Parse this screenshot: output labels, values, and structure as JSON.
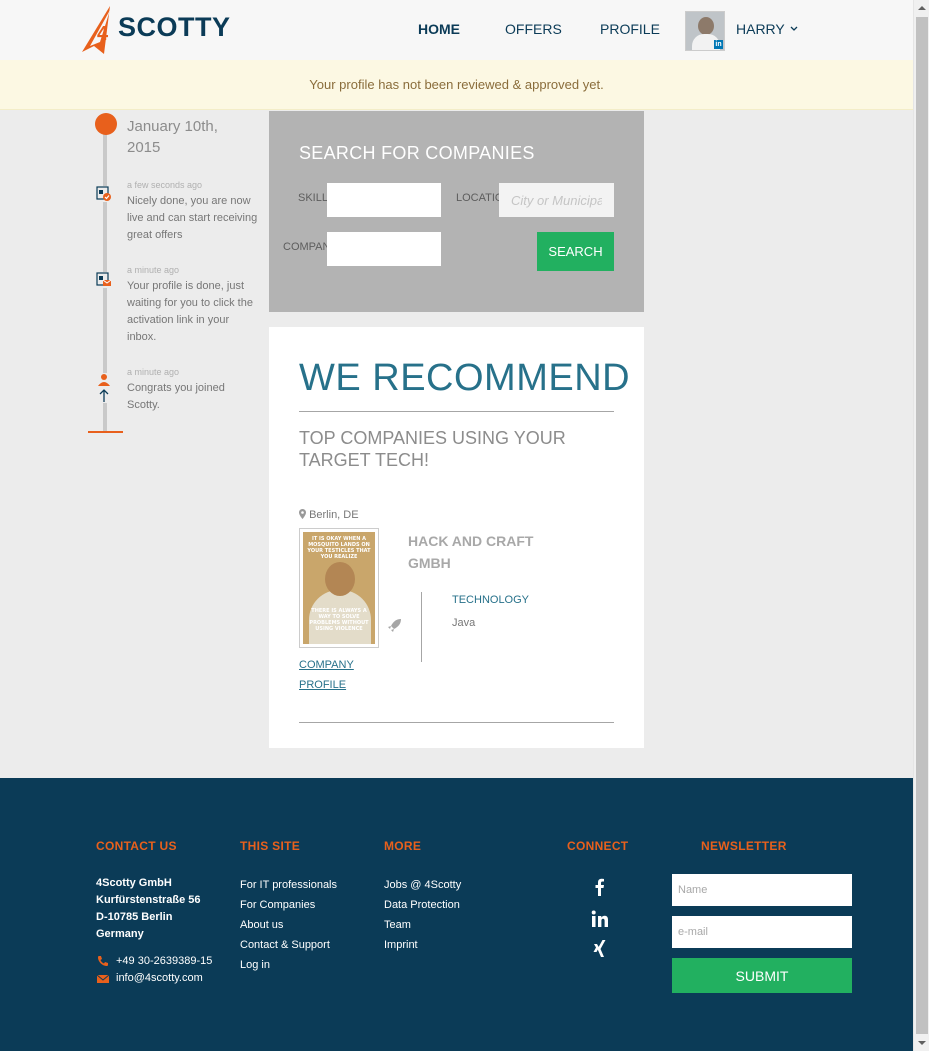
{
  "header": {
    "logo_text": "SCOTTY",
    "logo_number": "4",
    "nav": {
      "home": "HOME",
      "offers": "OFFERS",
      "profile": "PROFILE"
    },
    "user_name": "HARRY",
    "linkedin_badge": "in"
  },
  "alert": {
    "message": "Your profile has not been reviewed & approved yet."
  },
  "timeline": {
    "date": "January 10th, 2015",
    "events": [
      {
        "time": "a few seconds ago",
        "text": "Nicely done, you are now live and can start receiving great offers",
        "icon": "profile-check-icon"
      },
      {
        "time": "a minute ago",
        "text": "Your profile is done, just waiting for you to click the activation link in your inbox.",
        "icon": "profile-envelope-icon"
      },
      {
        "time": "a minute ago",
        "text": "Congrats you joined Scotty.",
        "icon": "user-joined-icon"
      }
    ]
  },
  "search": {
    "title": "SEARCH FOR COMPANIES",
    "skill_label": "SKILL",
    "location_label": "LOCATION",
    "company_label": "COMPANY",
    "skill_value": "",
    "location_placeholder": "City or Municipality",
    "company_value": "",
    "button": "SEARCH"
  },
  "recommend": {
    "title": "WE RECOMMEND",
    "subtitle": "TOP COMPANIES USING YOUR TARGET TECH!",
    "company": {
      "location": "Berlin, DE",
      "name": "HACK AND CRAFT GMBH",
      "tech_label": "TECHNOLOGY",
      "tech_value": "Java",
      "profile_link": "COMPANY PROFILE",
      "image_caption_top": "IT IS OKAY WHEN A MOSQUITO LANDS ON YOUR TESTICLES THAT YOU REALIZE",
      "image_caption_bottom": "THERE IS ALWAYS A WAY TO SOLVE PROBLEMS WITHOUT USING VIOLENCE"
    }
  },
  "footer": {
    "contact": {
      "heading": "CONTACT US",
      "address": [
        "4Scotty GmbH",
        "Kurfürstenstraße 56",
        "D-10785 Berlin",
        "Germany"
      ],
      "phone": "+49 30-2639389-15",
      "email": "info@4scotty.com"
    },
    "this_site": {
      "heading": "THIS SITE",
      "links": [
        "For IT professionals",
        "For Companies",
        "About us",
        "Contact & Support",
        "Log in"
      ]
    },
    "more": {
      "heading": "MORE",
      "links": [
        "Jobs @ 4Scotty",
        "Data Protection",
        "Team",
        "Imprint"
      ]
    },
    "connect": {
      "heading": "CONNECT",
      "icons": [
        "facebook-icon",
        "linkedin-icon",
        "xing-icon"
      ]
    },
    "newsletter": {
      "heading": "NEWSLETTER",
      "name_placeholder": "Name",
      "email_placeholder": "e-mail",
      "button": "SUBMIT"
    }
  },
  "colors": {
    "brand_orange": "#e8601c",
    "brand_navy": "#0b3b57",
    "teal": "#27718a",
    "green": "#22b060",
    "alert_bg": "#fcf8e3"
  }
}
